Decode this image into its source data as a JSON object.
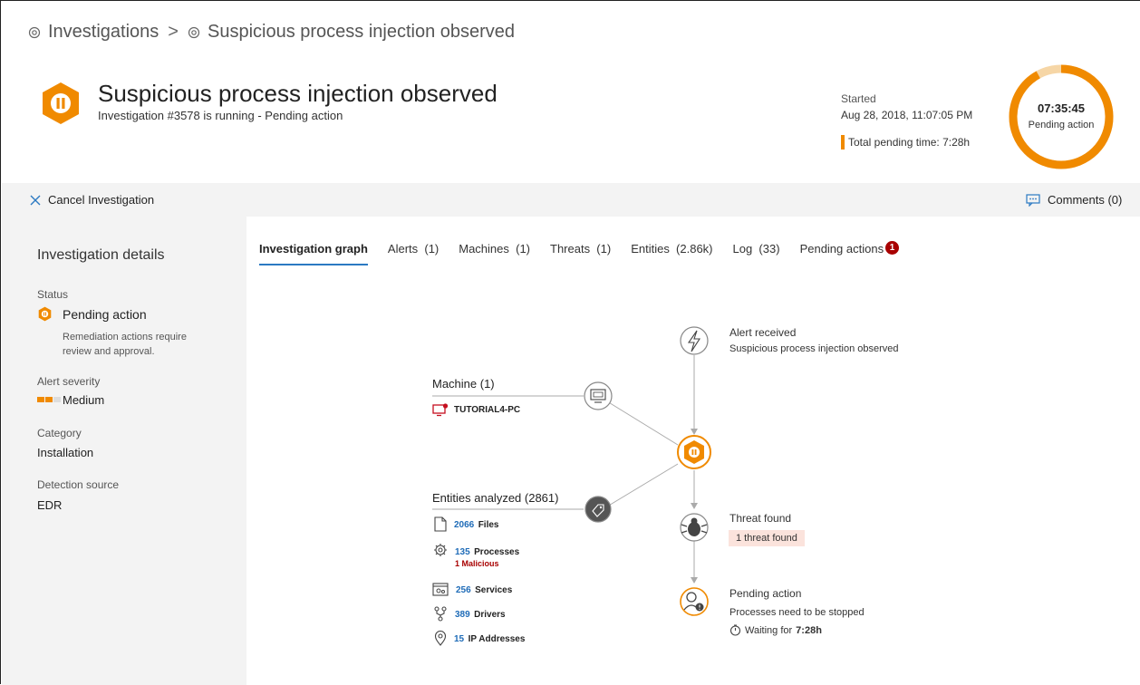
{
  "breadcrumb": {
    "root": "Investigations",
    "separator": ">",
    "current": "Suspicious process injection observed"
  },
  "header": {
    "title": "Suspicious process injection observed",
    "subtitle": "Investigation #3578 is running - Pending action",
    "started_label": "Started",
    "started_value": "Aug 28, 2018, 11:07:05 PM",
    "total_pending": "Total pending time: 7:28h",
    "timer_value": "07:35:45",
    "timer_status": "Pending action",
    "timer_progress": 0.92
  },
  "command_bar": {
    "cancel_label": "Cancel Investigation",
    "comments_label": "Comments (0)"
  },
  "details": {
    "heading": "Investigation details",
    "status_label": "Status",
    "status_value": "Pending action",
    "status_desc": "Remediation actions require review and approval.",
    "severity_label": "Alert severity",
    "severity_value": "Medium",
    "category_label": "Category",
    "category_value": "Installation",
    "source_label": "Detection source",
    "source_value": "EDR"
  },
  "tabs": [
    {
      "label": "Investigation graph",
      "active": true
    },
    {
      "label": "Alerts  (1)"
    },
    {
      "label": "Machines  (1)"
    },
    {
      "label": "Threats  (1)"
    },
    {
      "label": "Entities  (2.86k)"
    },
    {
      "label": "Log  (33)"
    },
    {
      "label": "Pending actions",
      "badge": "1"
    }
  ],
  "graph": {
    "alert_title": "Alert received",
    "alert_desc": "Suspicious process injection observed",
    "machine_title": "Machine (1)",
    "machine_name": "TUTORIAL4-PC",
    "entities_title": "Entities analyzed (2861)",
    "files_count": "2066",
    "files_label": "Files",
    "processes_count": "135",
    "processes_label": "Processes",
    "processes_malicious": "1 Malicious",
    "services_count": "256",
    "services_label": "Services",
    "drivers_count": "389",
    "drivers_label": "Drivers",
    "ip_count": "15",
    "ip_label": "IP Addresses",
    "threat_title": "Threat found",
    "threat_chip": "1 threat found",
    "pending_title": "Pending action",
    "pending_desc": "Processes need to be stopped",
    "waiting_prefix": "Waiting for",
    "waiting_value": "7:28h"
  },
  "colors": {
    "accent_orange": "#f08a00",
    "link_blue": "#1f6cb8",
    "tab_underline": "#2b79c2",
    "danger": "#a80000"
  }
}
